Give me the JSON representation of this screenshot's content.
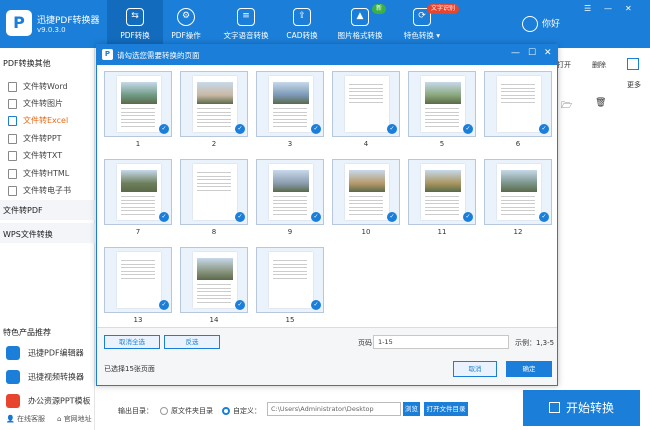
{
  "app": {
    "name": "迅捷PDF转换器",
    "version": "v9.0.3.0"
  },
  "top_tabs": [
    {
      "label": "PDF转换",
      "icon": "pdf-convert-icon",
      "active": true
    },
    {
      "label": "PDF操作",
      "icon": "pdf-operate-icon"
    },
    {
      "label": "文字语音转换",
      "icon": "voice-icon"
    },
    {
      "label": "CAD转换",
      "icon": "cad-icon"
    },
    {
      "label": "图片格式转换",
      "icon": "image-icon"
    },
    {
      "label": "特色转换",
      "icon": "feature-icon"
    }
  ],
  "badges": {
    "new": "新",
    "ocr": "文字识别"
  },
  "user": {
    "name": "你好"
  },
  "sidebar": {
    "section_pdf": "PDF转换其他",
    "items": [
      "文件转Word",
      "文件转图片",
      "文件转Excel",
      "文件转PPT",
      "文件转TXT",
      "文件转HTML",
      "文件转电子书"
    ],
    "active_index": 2,
    "section_to_pdf": "文件转PDF",
    "section_wps": "WPS文件转换",
    "products_title": "特色产品推荐",
    "products": [
      "迅捷PDF编辑器",
      "迅捷视频转换器",
      "办公资源PPT模板"
    ],
    "footer_service": "在线客服",
    "footer_site": "官网地址"
  },
  "right_pane": {
    "open": "打开",
    "delete": "删除",
    "more": "更多"
  },
  "output": {
    "label": "输出目录：",
    "option_source": "原文件夹目录",
    "option_custom": "自定义：",
    "path": "C:\\Users\\Administrator\\Desktop",
    "browse": "浏览",
    "open_folder": "打开文件目录",
    "start": "开始转换"
  },
  "dialog": {
    "title": "请勾选您需要转换的页面",
    "pages": [
      {
        "n": "1",
        "photo": true,
        "color": "#6f9a83"
      },
      {
        "n": "2",
        "photo": true,
        "color": "#c9b8a3"
      },
      {
        "n": "3",
        "photo": true,
        "color": "#7b98b6"
      },
      {
        "n": "4",
        "photo": false
      },
      {
        "n": "5",
        "photo": true,
        "color": "#8aa77a"
      },
      {
        "n": "6",
        "photo": false
      },
      {
        "n": "7",
        "photo": true,
        "color": "#6e7f5c"
      },
      {
        "n": "8",
        "photo": false
      },
      {
        "n": "9",
        "photo": true,
        "color": "#8c9db0"
      },
      {
        "n": "10",
        "photo": true,
        "color": "#b89a6b"
      },
      {
        "n": "11",
        "photo": true,
        "color": "#a99760"
      },
      {
        "n": "12",
        "photo": true,
        "color": "#7a958a"
      },
      {
        "n": "13",
        "photo": false
      },
      {
        "n": "14",
        "photo": true,
        "color": "#8b9580"
      },
      {
        "n": "15",
        "photo": false
      }
    ],
    "btn_deselect_all": "取消全选",
    "btn_invert": "反选",
    "range_label": "页码",
    "range_value": "1-15",
    "example": "示例：1,3-5",
    "selected_text": "已选择15张页面",
    "btn_cancel": "取消",
    "btn_ok": "确定"
  },
  "colors": {
    "accent": "#1b7fd9",
    "active_item": "#e46b1a"
  }
}
